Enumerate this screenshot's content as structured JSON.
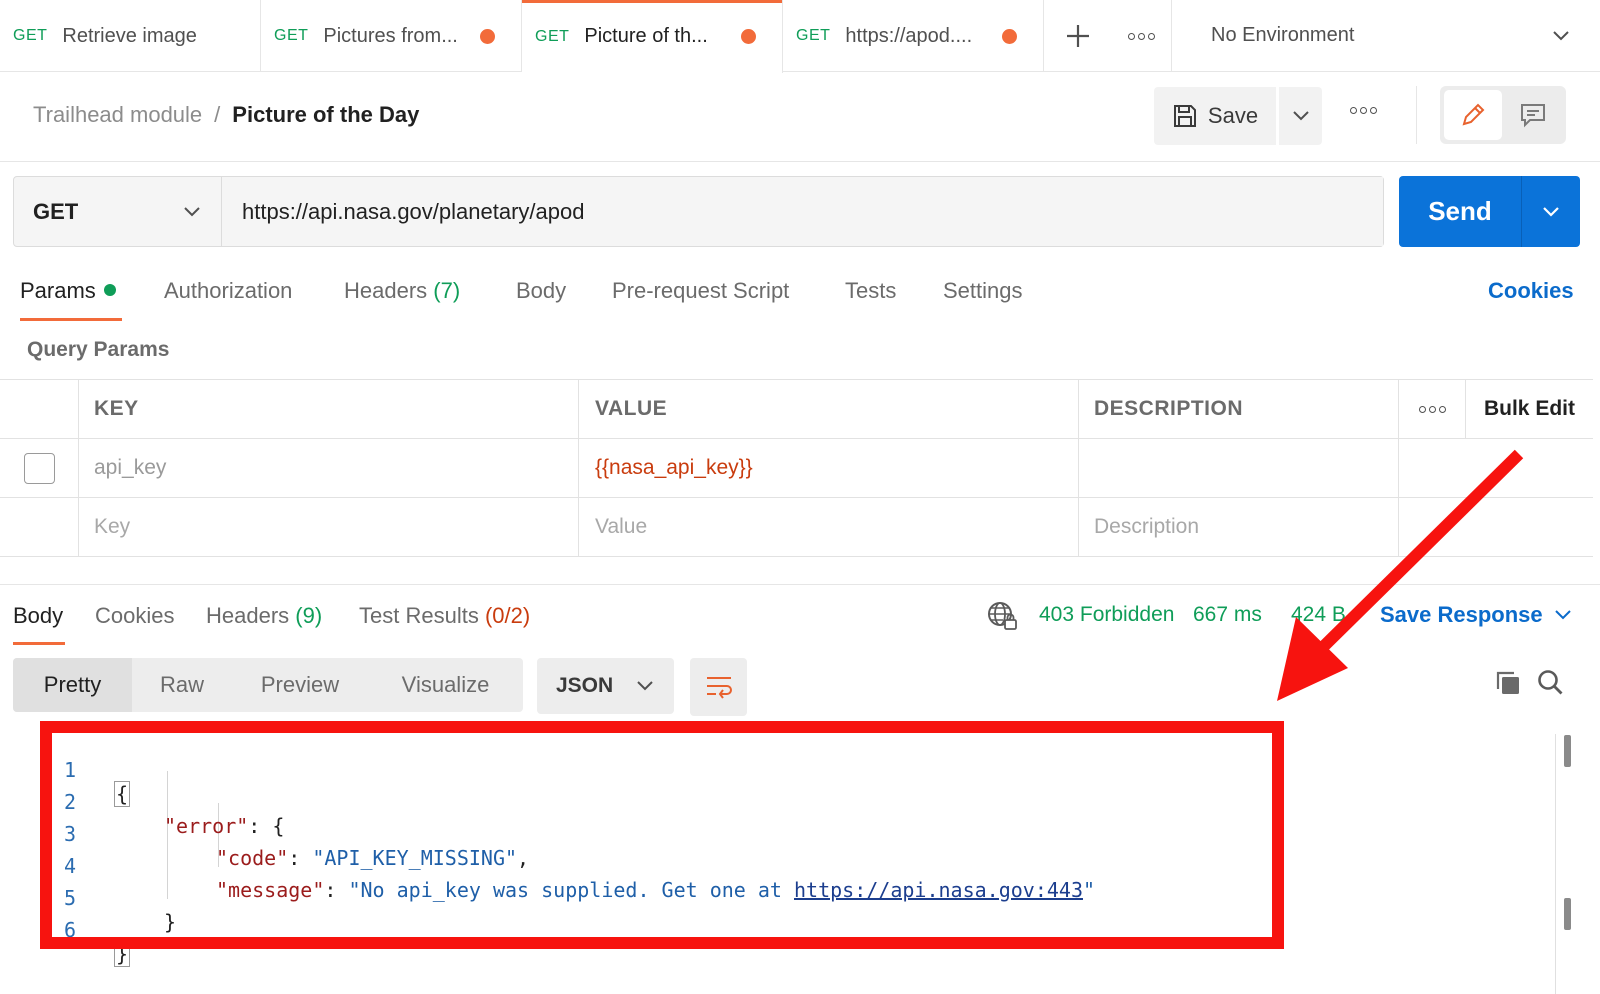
{
  "tabs": [
    {
      "method": "GET",
      "title": "Retrieve image",
      "unsaved": false,
      "active": false
    },
    {
      "method": "GET",
      "title": "Pictures from...",
      "unsaved": true,
      "active": false
    },
    {
      "method": "GET",
      "title": "Picture of th...",
      "unsaved": true,
      "active": true
    },
    {
      "method": "GET",
      "title": "https://apod....",
      "unsaved": true,
      "active": false
    }
  ],
  "environment": {
    "selected": "No Environment"
  },
  "breadcrumb": {
    "parent": "Trailhead module",
    "separator": "/",
    "current": "Picture of the Day"
  },
  "header": {
    "save_label": "Save"
  },
  "request": {
    "method": "GET",
    "url": "https://api.nasa.gov/planetary/apod",
    "send_label": "Send"
  },
  "request_tabs": {
    "params": "Params",
    "authorization": "Authorization",
    "headers": "Headers",
    "headers_count": "(7)",
    "body": "Body",
    "prerequest": "Pre-request Script",
    "tests": "Tests",
    "settings": "Settings",
    "cookies": "Cookies"
  },
  "query_params": {
    "title": "Query Params",
    "columns": {
      "key": "KEY",
      "value": "VALUE",
      "description": "DESCRIPTION",
      "bulk_edit": "Bulk Edit"
    },
    "rows": [
      {
        "key": "api_key",
        "value": "{{nasa_api_key}}",
        "description": "",
        "checked": false
      }
    ],
    "placeholders": {
      "key": "Key",
      "value": "Value",
      "description": "Description"
    }
  },
  "response": {
    "tabs": {
      "body": "Body",
      "cookies": "Cookies",
      "headers": "Headers",
      "headers_count": "(9)",
      "test_results": "Test Results",
      "test_results_count": "(0/2)"
    },
    "status": "403 Forbidden",
    "time": "667 ms",
    "size": "424 B",
    "save_response": "Save Response",
    "formats": [
      "Pretty",
      "Raw",
      "Preview",
      "Visualize"
    ],
    "active_format": "Pretty",
    "language": "JSON",
    "code": {
      "line_numbers": [
        "1",
        "2",
        "3",
        "4",
        "5",
        "6"
      ],
      "open_brace": "{",
      "error_key": "\"error\"",
      "code_key": "\"code\"",
      "code_value": "\"API_KEY_MISSING\"",
      "message_key": "\"message\"",
      "message_prefix": "\"No api_key was supplied. Get one at ",
      "message_link": "https://api.nasa.gov:443",
      "message_suffix": "\"",
      "inner_close": "}",
      "close_brace": "}"
    }
  },
  "colors": {
    "accent_orange": "#f26b3a",
    "send_blue": "#0b73d9",
    "success_green": "#0f9d58",
    "annotation_red": "#f7130f"
  },
  "icons": [
    "plus-icon",
    "more-icon",
    "chevron-down-icon",
    "save-icon",
    "edit-icon",
    "comment-icon",
    "globe-lock-icon",
    "wrap-lines-icon",
    "copy-icon",
    "search-icon"
  ]
}
